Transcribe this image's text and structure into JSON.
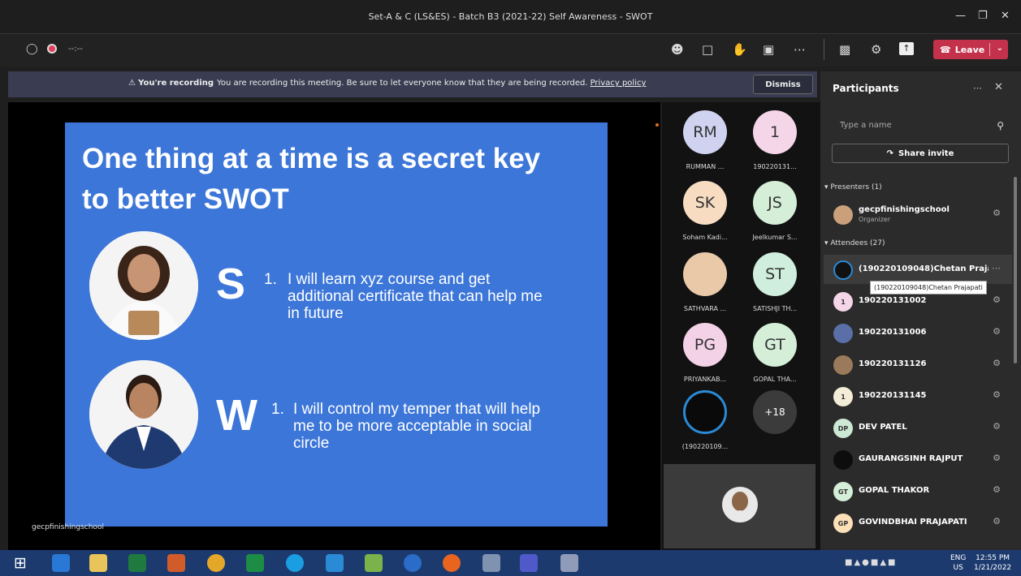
{
  "window": {
    "title": "Set-A & C (LS&ES) - Batch B3 (2021-22) Self Awareness - SWOT",
    "timer": "--:--"
  },
  "toolbar": {
    "leave_label": "Leave"
  },
  "banner": {
    "bold": "You're recording",
    "message": "You are recording this meeting. Be sure to let everyone know that they are being recorded.",
    "link": "Privacy policy",
    "dismiss": "Dismiss"
  },
  "slide": {
    "heading": "One thing at a time is a secret key to better SWOT",
    "points": [
      {
        "letter": "S",
        "number": "1.",
        "text": "I will learn xyz course and get additional certificate that can help me in future"
      },
      {
        "letter": "W",
        "number": "1.",
        "text": "I will control my temper that will help me to be more acceptable in social circle"
      }
    ],
    "watermark": "gecpfinishingschool"
  },
  "gallery": [
    {
      "initials": "RM",
      "name": "RUMMAN ...",
      "color": "#d0d3f0"
    },
    {
      "initials": "1",
      "name": "190220131...",
      "color": "#f5d6e8"
    },
    {
      "initials": "SK",
      "name": "Soham Kadi...",
      "color": "#f8dcc2"
    },
    {
      "initials": "JS",
      "name": "Jeelkumar S...",
      "color": "#d4eed8"
    },
    {
      "initials": "",
      "name": "SATHVARA ...",
      "color": "#e9c9a8"
    },
    {
      "initials": "ST",
      "name": "SATISHJI TH...",
      "color": "#cfeedd"
    },
    {
      "initials": "PG",
      "name": "PRIYANKAB...",
      "color": "#f3d1e6"
    },
    {
      "initials": "GT",
      "name": "GOPAL THA...",
      "color": "#d4eed8"
    },
    {
      "initials": "",
      "name": "(190220109...",
      "color": "#0a0a0a"
    },
    {
      "initials": "+18",
      "name": "",
      "color": "#3b3b3b"
    }
  ],
  "panel": {
    "title": "Participants",
    "search_placeholder": "Type a name",
    "share_invite": "Share invite",
    "presenters_header": "Presenters (1)",
    "attendees_header": "Attendees (27)",
    "presenters": [
      {
        "name": "gecpfinishingschool",
        "role": "Organizer",
        "initials": "",
        "color": "#c9a07a"
      }
    ],
    "attendees": [
      {
        "name": "(190220109048)Chetan Praja...",
        "initials": "",
        "color": "#111"
      },
      {
        "name": "190220131002",
        "initials": "1",
        "color": "#f5d6e8"
      },
      {
        "name": "190220131006",
        "initials": "",
        "color": "#5a6fa8"
      },
      {
        "name": "190220131126",
        "initials": "",
        "color": "#9a7a5a"
      },
      {
        "name": "190220131145",
        "initials": "1",
        "color": "#f3ecd6"
      },
      {
        "name": "DEV PATEL",
        "initials": "DP",
        "color": "#cde9d5"
      },
      {
        "name": "GAURANGSINH RAJPUT",
        "initials": "",
        "color": "#0d0d0d"
      },
      {
        "name": "GOPAL THAKOR",
        "initials": "GT",
        "color": "#d4eed8"
      },
      {
        "name": "GOVINDBHAI PRAJAPATI",
        "initials": "GP",
        "color": "#fde0b8"
      }
    ],
    "tooltip": "(190220109048)Chetan Prajapati"
  },
  "taskbar": {
    "lang": "ENG",
    "region": "US",
    "time": "12:55 PM",
    "date": "1/21/2022"
  }
}
